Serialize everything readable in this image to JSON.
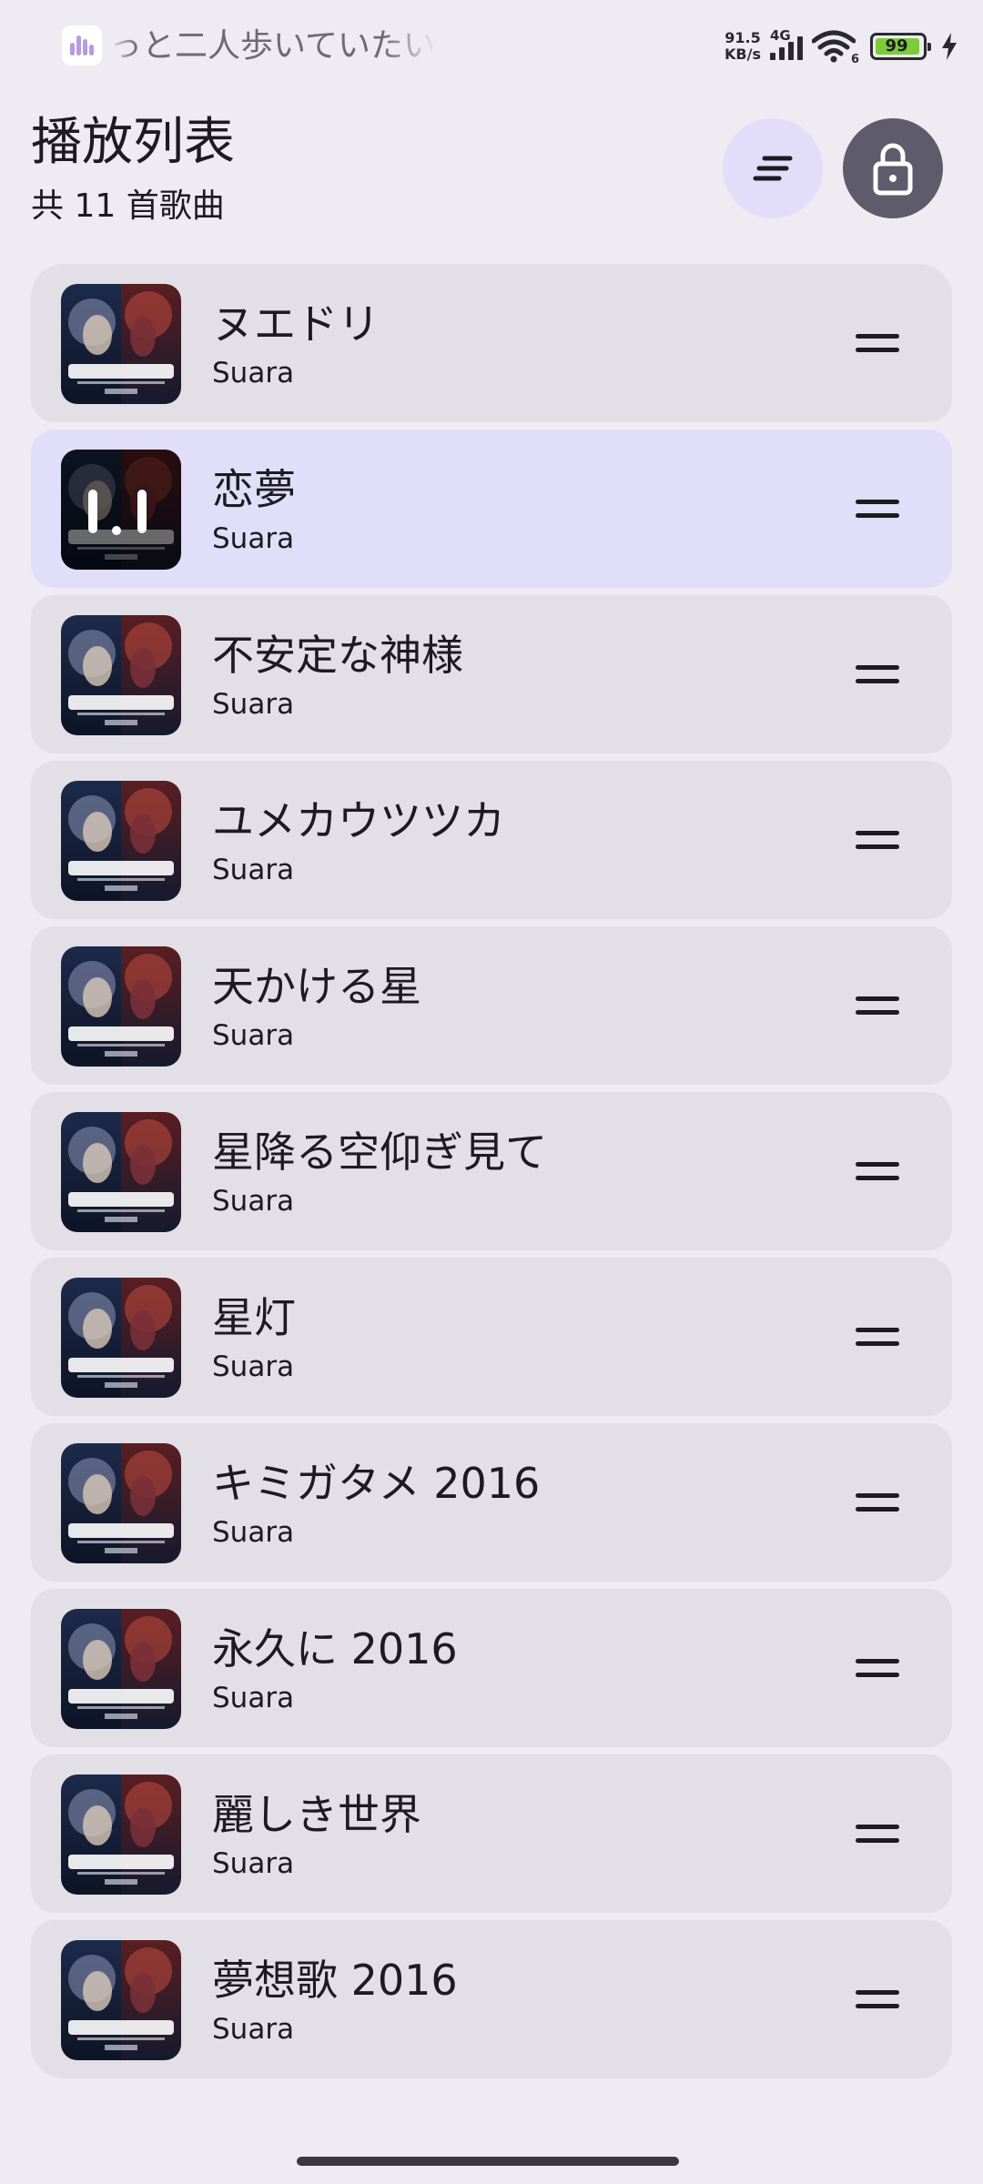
{
  "status_bar": {
    "now_playing_icon": "audio-waveform-icon",
    "now_playing_text": "っと二人歩いていたい",
    "speed_value": "91.5",
    "speed_unit": "KB/s",
    "network_type": "4G",
    "wifi_badge": "6",
    "battery_level": "99",
    "charging_icon": "lightning-icon"
  },
  "header": {
    "title": "播放列表",
    "subtitle": "共 11 首歌曲",
    "sort_icon": "sort-icon",
    "lock_icon": "lock-icon"
  },
  "playlist": {
    "items": [
      {
        "title": "ヌエドリ",
        "artist": "Suara"
      },
      {
        "title": "恋夢",
        "artist": "Suara",
        "playing": true
      },
      {
        "title": "不安定な神様",
        "artist": "Suara"
      },
      {
        "title": "ユメカウツツカ",
        "artist": "Suara"
      },
      {
        "title": "天かける星",
        "artist": "Suara"
      },
      {
        "title": "星降る空仰ぎ見て",
        "artist": "Suara"
      },
      {
        "title": "星灯",
        "artist": "Suara"
      },
      {
        "title": "キミガタメ 2016",
        "artist": "Suara"
      },
      {
        "title": "永久に 2016",
        "artist": "Suara"
      },
      {
        "title": "麗しき世界",
        "artist": "Suara"
      },
      {
        "title": "夢想歌 2016",
        "artist": "Suara"
      }
    ]
  },
  "colors": {
    "background": "#efebf3",
    "item_background": "#e3dfe7",
    "active_item_background": "#e1defa",
    "sort_button": "#e2ddf9",
    "lock_button": "#5e5b6b",
    "battery_fill": "#7ccc3a"
  }
}
